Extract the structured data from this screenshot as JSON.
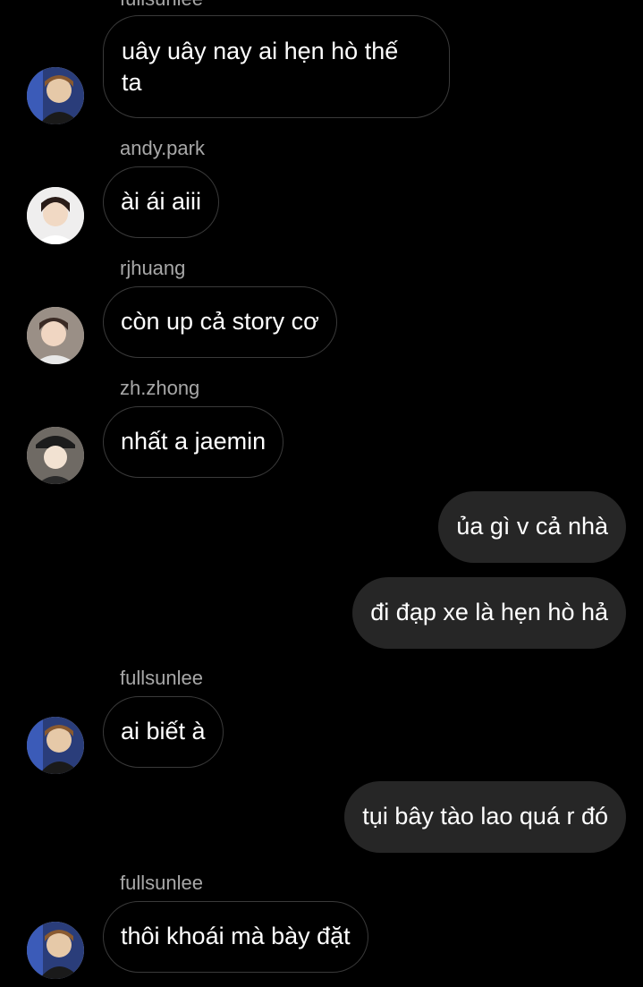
{
  "messages": [
    {
      "sender": "fullsunlee",
      "text_lines": [
        "uây uây nay ai hẹn hò thế",
        "ta"
      ],
      "avatar_icon": "profile-avatar-fullsunlee"
    },
    {
      "sender": "andy.park",
      "text": "ài ái aiii",
      "avatar_icon": "profile-avatar-andy-park"
    },
    {
      "sender": "rjhuang",
      "text": "còn up cả story cơ",
      "avatar_icon": "profile-avatar-rjhuang"
    },
    {
      "sender": "zh.zhong",
      "text": "nhất a jaemin",
      "avatar_icon": "profile-avatar-zh-zhong"
    },
    {
      "sender": "me",
      "text": "ủa gì v cả nhà"
    },
    {
      "sender": "me",
      "text": "đi đạp xe là hẹn hò hả"
    },
    {
      "sender": "fullsunlee",
      "text": "ai biết à",
      "avatar_icon": "profile-avatar-fullsunlee"
    },
    {
      "sender": "me",
      "text": "tụi bây tào lao quá r đó"
    },
    {
      "sender": "fullsunlee",
      "text": "thôi khoái mà bày đặt",
      "avatar_icon": "profile-avatar-fullsunlee"
    }
  ],
  "colors": {
    "background": "#000000",
    "incoming_border": "#3a3a3a",
    "outgoing_bubble": "#262626",
    "sender_label": "#a8a8a8",
    "text": "#ffffff"
  }
}
